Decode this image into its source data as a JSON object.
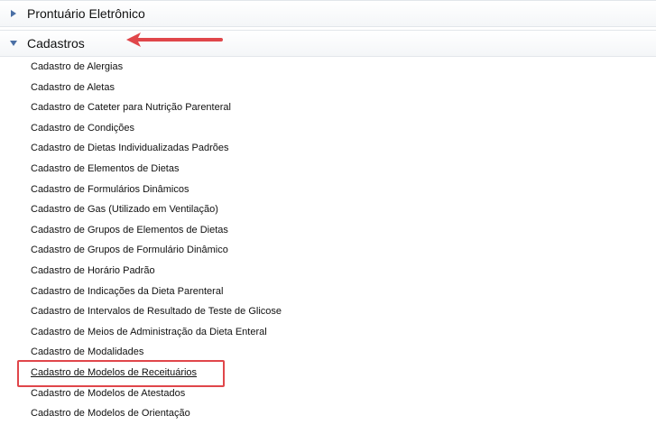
{
  "sections": [
    {
      "title": "Prontuário Eletrônico",
      "expanded": false,
      "icon": "triangle-right-icon"
    },
    {
      "title": "Cadastros",
      "expanded": true,
      "icon": "triangle-down-icon"
    }
  ],
  "items": [
    "Cadastro de Alergias",
    "Cadastro de Aletas",
    "Cadastro de Cateter para Nutrição Parenteral",
    "Cadastro de Condições",
    "Cadastro de Dietas Individualizadas Padrões",
    "Cadastro de Elementos de Dietas",
    "Cadastro de Formulários Dinâmicos",
    "Cadastro de Gas (Utilizado em Ventilação)",
    "Cadastro de Grupos de Elementos de Dietas",
    "Cadastro de Grupos de Formulário Dinâmico",
    "Cadastro de Horário Padrão",
    "Cadastro de Indicações da Dieta Parenteral",
    "Cadastro de Intervalos de Resultado de Teste de Glicose",
    "Cadastro de Meios de Administração da Dieta Enteral",
    "Cadastro de Modalidades",
    "Cadastro de Modelos de Receituários",
    "Cadastro de Modelos de Atestados",
    "Cadastro de Modelos de Orientação"
  ],
  "active_item": "Cadastro de Modelos de Receituários",
  "colors": {
    "icon": "#4a6fa5",
    "annotation": "#e0464a"
  }
}
